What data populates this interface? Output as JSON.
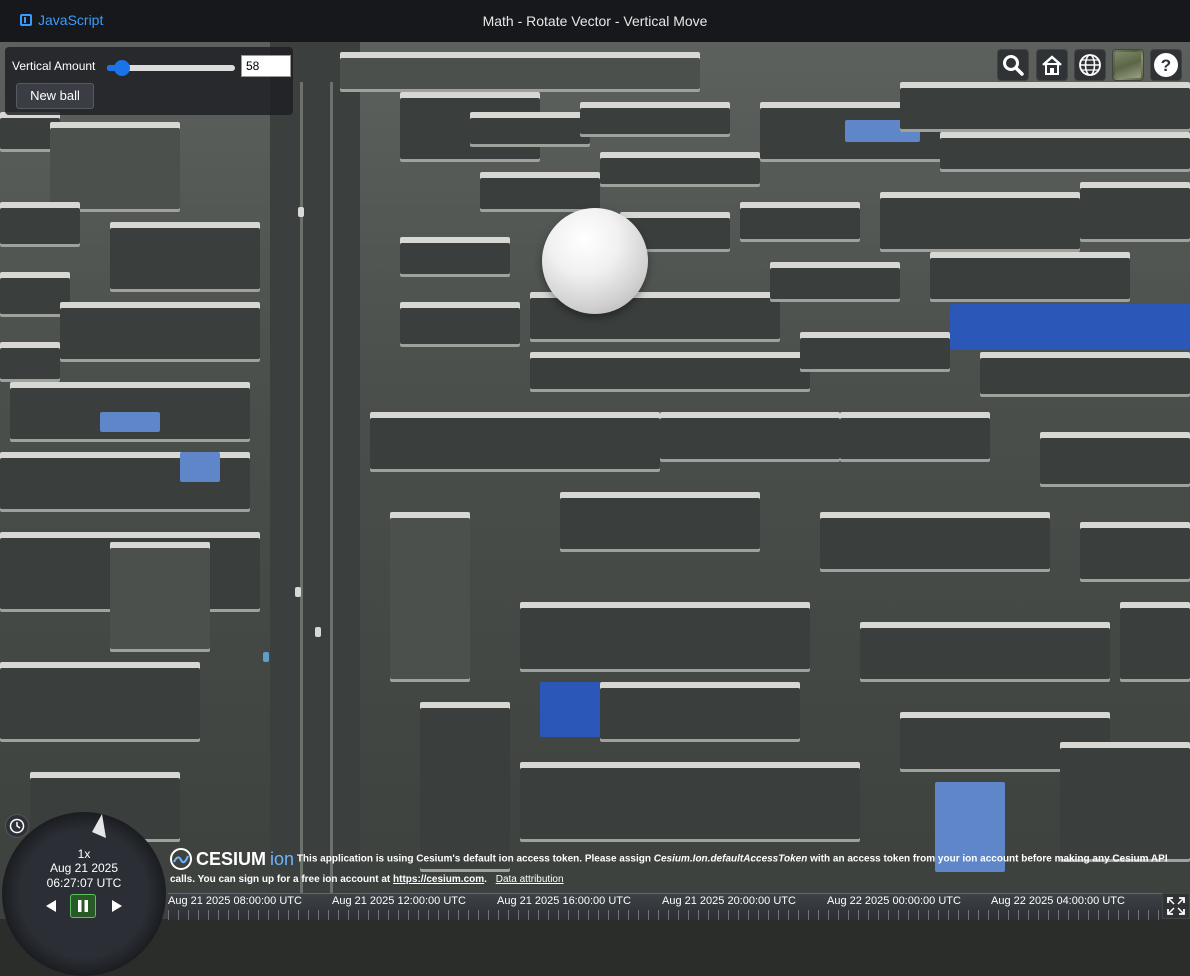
{
  "header": {
    "js_link_label": "JavaScript",
    "title": "Math - Rotate Vector - Vertical Move"
  },
  "toolbar": {
    "slider_label": "Vertical Amount",
    "slider_value": "58",
    "slider_fraction": 0.12,
    "new_ball_label": "New ball"
  },
  "viewer_tools": [
    "search-icon",
    "home-icon",
    "globe-icon",
    "imagery-picker-icon",
    "help-icon"
  ],
  "animation": {
    "speed": "1x",
    "date": "Aug 21 2025",
    "time": "06:27:07 UTC"
  },
  "credits": {
    "logo_main": "CESIUM",
    "logo_sub": "ion",
    "message_1": "This application is using Cesium's default ion access token. Please assign",
    "message_em": "Cesium.Ion.defaultAccessToken",
    "message_2": "with an access token from your ion account before making any Cesium API calls. You can sign up for a free ion account at",
    "link": "https://cesium.com",
    "link_tail": ".",
    "data_attribution": "Data attribution"
  },
  "timeline": {
    "labels": [
      "Aug 21 2025 08:00:00 UTC",
      "Aug 21 2025 12:00:00 UTC",
      "Aug 21 2025 16:00:00 UTC",
      "Aug 21 2025 20:00:00 UTC",
      "Aug 22 2025 00:00:00 UTC",
      "Aug 22 2025 04:00:00 UTC"
    ]
  }
}
